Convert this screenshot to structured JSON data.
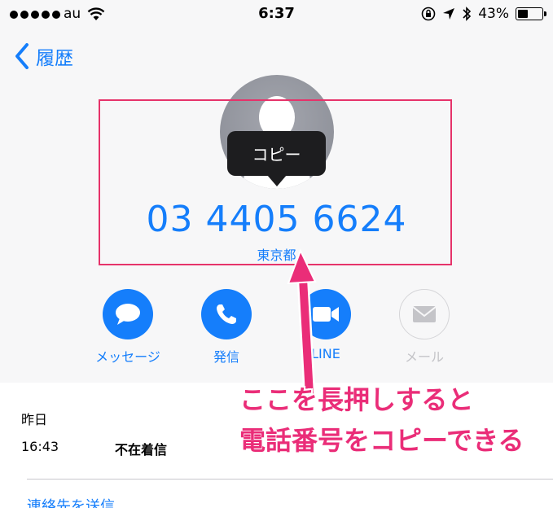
{
  "status_bar": {
    "carrier": "au",
    "time": "6:37",
    "battery_percent": "43%",
    "battery_level": 0.43
  },
  "nav": {
    "back_label": "履歴"
  },
  "contact": {
    "phone_number": "03 4405 6624",
    "phone_label": "東京都",
    "tooltip": "コピー"
  },
  "actions": [
    {
      "label": "メッセージ",
      "icon": "message-bubble-icon",
      "enabled": true
    },
    {
      "label": "発信",
      "icon": "phone-icon",
      "enabled": true
    },
    {
      "label": "LINE",
      "icon": "video-camera-icon",
      "enabled": true
    },
    {
      "label": "メール",
      "icon": "mail-icon",
      "enabled": false
    }
  ],
  "history": {
    "date_label": "昨日",
    "entries": [
      {
        "time": "16:43",
        "type": "不在着信"
      }
    ]
  },
  "send_contact_label": "連絡先を送信",
  "annotation": {
    "line1": "ここを長押しすると",
    "line2": "電話番号をコピーできる"
  },
  "colors": {
    "accent": "#157efb",
    "annotation": "#ea2d78"
  }
}
